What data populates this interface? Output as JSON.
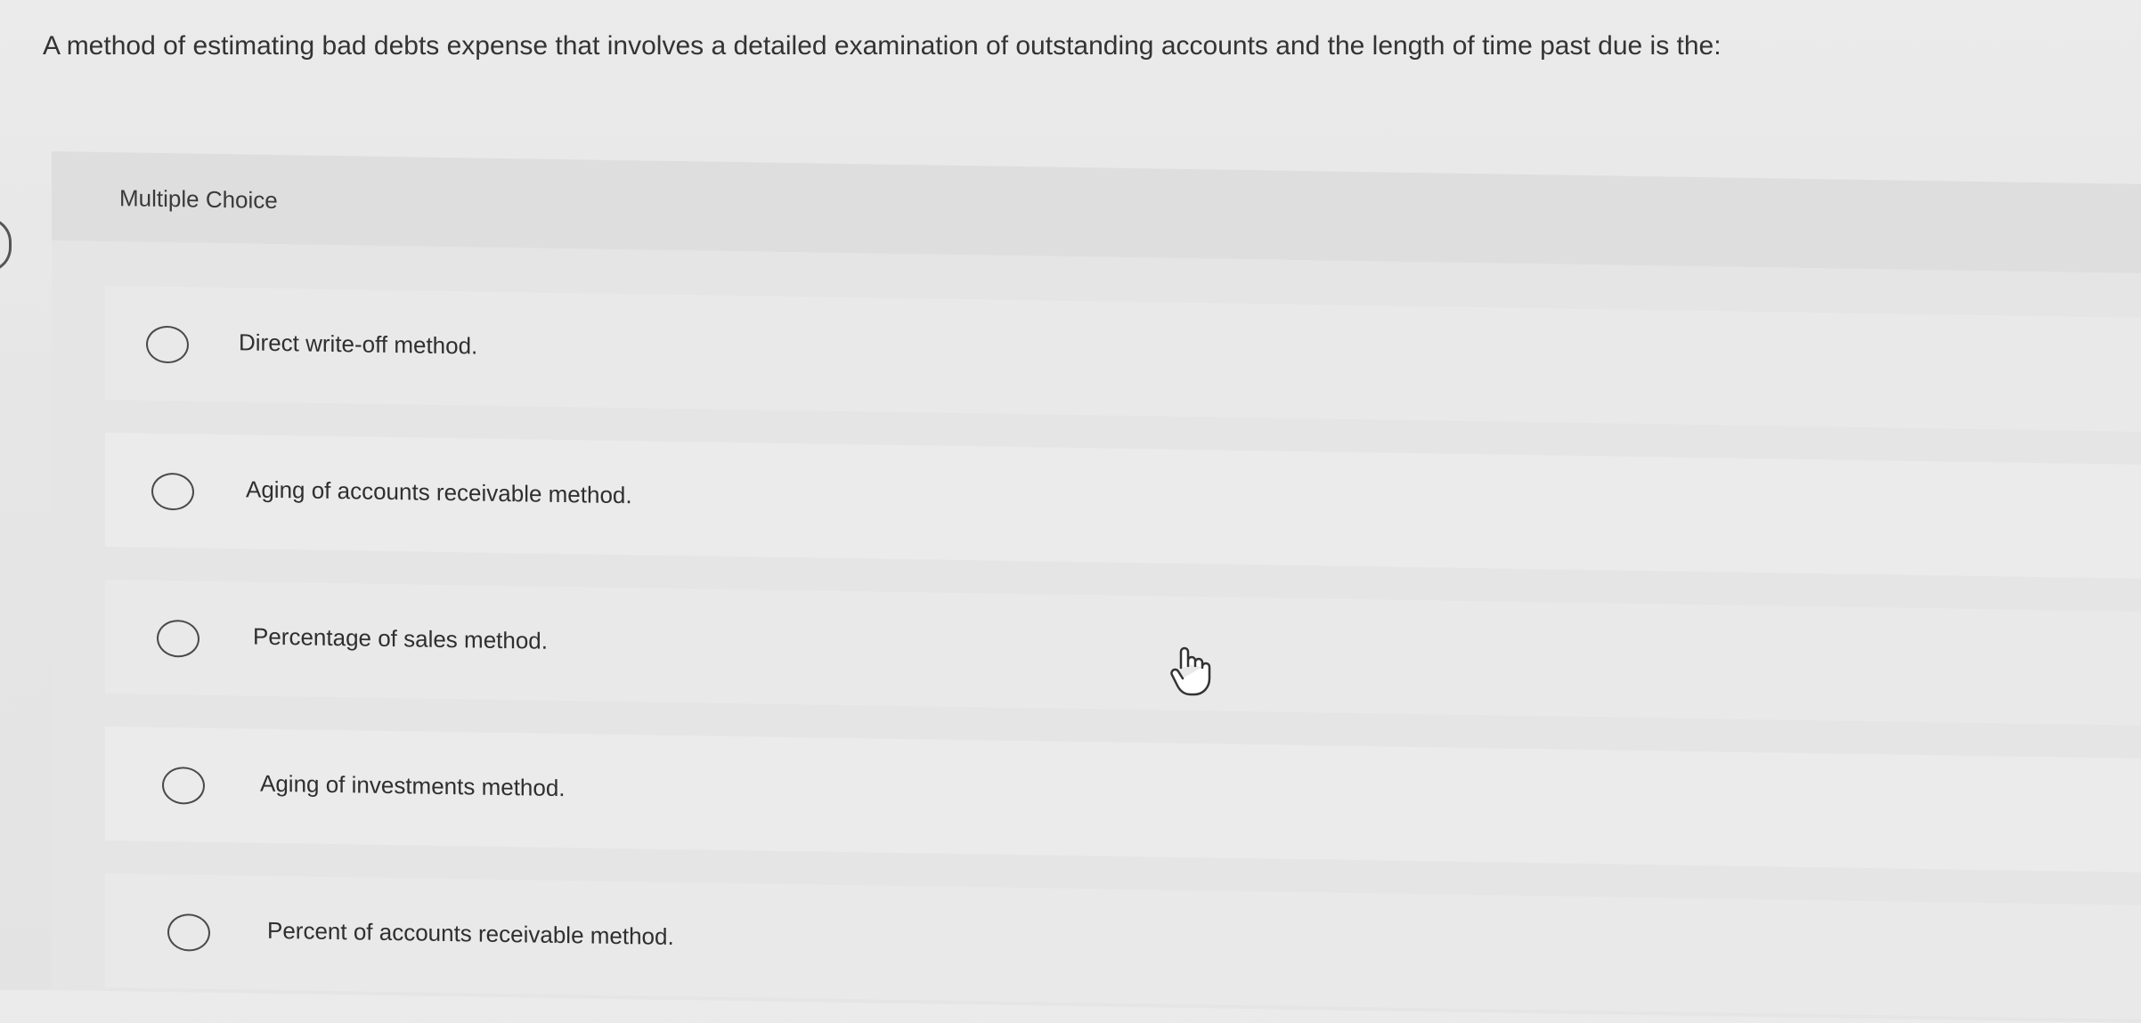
{
  "question": {
    "text": "A method of estimating bad debts expense that involves a detailed examination of outstanding accounts and the length of time past due is the:"
  },
  "answer_section": {
    "label": "Multiple Choice",
    "options": [
      {
        "label": "Direct write-off method."
      },
      {
        "label": "Aging of accounts receivable method."
      },
      {
        "label": "Percentage of sales method."
      },
      {
        "label": "Aging of investments method."
      },
      {
        "label": "Percent of accounts receivable method."
      }
    ]
  },
  "icons": {
    "radio": "radio-unselected-icon",
    "cursor": "hand-pointer-icon"
  },
  "colors": {
    "background": "#e6e6e6",
    "text": "#333333",
    "radio_border": "#4a4a4a"
  }
}
